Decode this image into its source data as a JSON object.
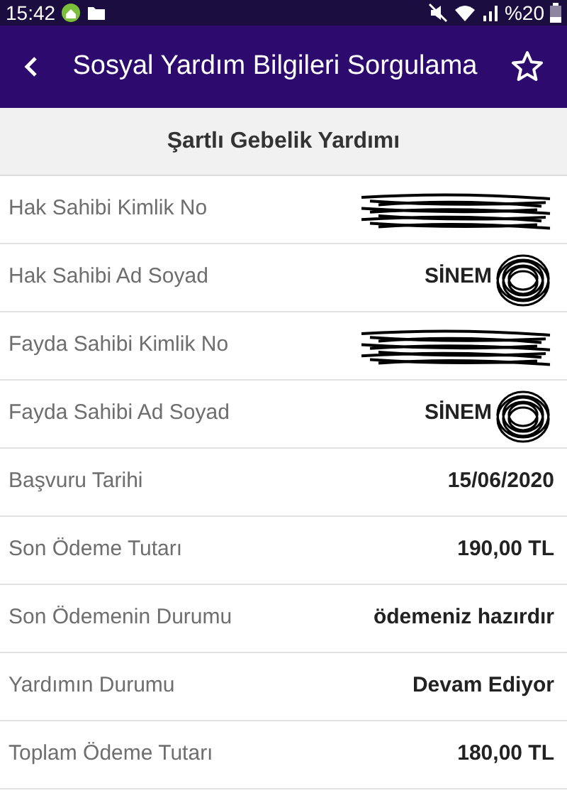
{
  "status_bar": {
    "time": "15:42",
    "battery": "%20"
  },
  "app_bar": {
    "title": "Sosyal Yardım Bilgileri Sorgulama"
  },
  "section": {
    "title": "Şartlı Gebelik Yardımı"
  },
  "rows": [
    {
      "label": "Hak Sahibi Kimlik No",
      "redacted": true
    },
    {
      "label": "Hak Sahibi Ad Soyad",
      "value": "SİNEM",
      "redacted": true
    },
    {
      "label": "Fayda Sahibi Kimlik No",
      "redacted": true
    },
    {
      "label": "Fayda Sahibi Ad Soyad",
      "value": "SİNEM",
      "redacted": true
    },
    {
      "label": "Başvuru Tarihi",
      "value": "15/06/2020",
      "redacted": false
    },
    {
      "label": "Son Ödeme Tutarı",
      "value": "190,00 TL",
      "redacted": false
    },
    {
      "label": "Son Ödemenin Durumu",
      "value": "ödemeniz hazırdır",
      "redacted": false
    },
    {
      "label": "Yardımın Durumu",
      "value": "Devam Ediyor",
      "redacted": false
    },
    {
      "label": "Toplam Ödeme Tutarı",
      "value": "180,00 TL",
      "redacted": false
    }
  ]
}
